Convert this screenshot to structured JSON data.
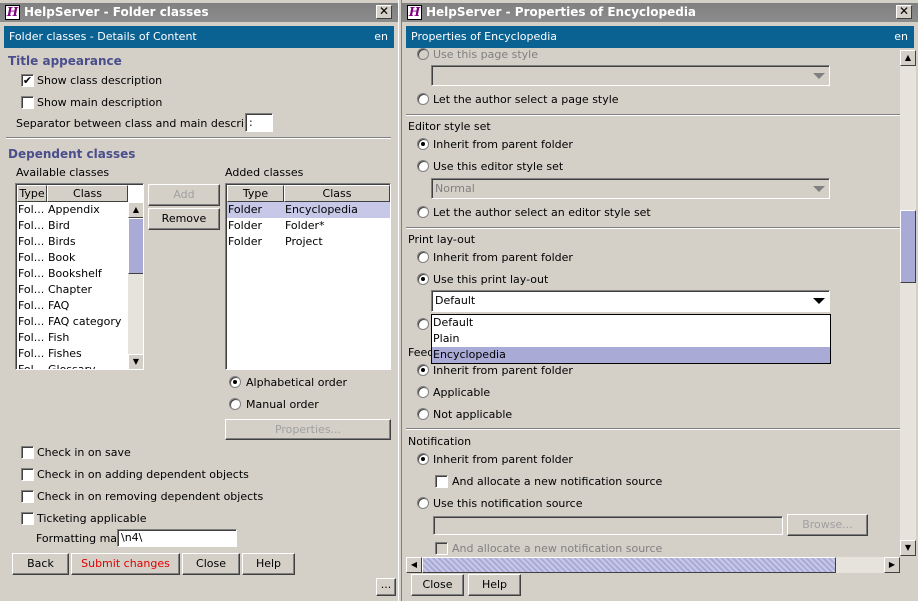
{
  "left": {
    "title": "HelpServer - Folder classes",
    "header": {
      "title": "Folder classes - Details of Content",
      "lang": "en"
    },
    "title_appearance": {
      "heading": "Title appearance",
      "show_class_description": "Show class description",
      "show_main_description": "Show main description",
      "separator_label": "Separator between class and main description",
      "separator_value": ":"
    },
    "dependent": {
      "heading": "Dependent classes",
      "available_label": "Available classes",
      "added_label": "Added classes",
      "col_type": "Type",
      "col_class": "Class",
      "available": [
        {
          "type": "Fol...",
          "cls": "Appendix"
        },
        {
          "type": "Fol...",
          "cls": "Bird"
        },
        {
          "type": "Fol...",
          "cls": "Birds"
        },
        {
          "type": "Fol...",
          "cls": "Book"
        },
        {
          "type": "Fol...",
          "cls": "Bookshelf"
        },
        {
          "type": "Fol...",
          "cls": "Chapter"
        },
        {
          "type": "Fol...",
          "cls": "FAQ"
        },
        {
          "type": "Fol...",
          "cls": "FAQ category"
        },
        {
          "type": "Fol...",
          "cls": "Fish"
        },
        {
          "type": "Fol...",
          "cls": "Fishes"
        },
        {
          "type": "Fol...",
          "cls": "Glossary"
        }
      ],
      "added": [
        {
          "type": "Folder",
          "cls": "Encyclopedia"
        },
        {
          "type": "Folder",
          "cls": "Folder*"
        },
        {
          "type": "Folder",
          "cls": "Project"
        }
      ],
      "add": "Add",
      "remove": "Remove",
      "alpha": "Alphabetical order",
      "manual": "Manual order",
      "properties": "Properties..."
    },
    "options": {
      "check_in_on_save": "Check in on save",
      "check_in_adding": "Check in on adding dependent objects",
      "check_in_removing": "Check in on removing dependent objects",
      "ticketing": "Ticketing applicable",
      "formatting_label": "Formatting mask",
      "formatting_value": "\\n4\\"
    },
    "footer": {
      "back": "Back",
      "submit": "Submit changes",
      "close": "Close",
      "help": "Help",
      "more": "..."
    }
  },
  "right": {
    "title": "HelpServer - Properties of Encyclopedia",
    "header": {
      "title": "Properties of Encyclopedia",
      "lang": "en"
    },
    "page_style": {
      "use": "Use this page style",
      "author": "Let the author select a page style"
    },
    "editor": {
      "heading": "Editor style set",
      "inherit": "Inherit from parent folder",
      "use": "Use this editor style set",
      "value": "Normal",
      "author": "Let the author select an editor style set"
    },
    "print": {
      "heading": "Print lay-out",
      "inherit": "Inherit from parent folder",
      "use": "Use this print lay-out",
      "value": "Default",
      "options": [
        "Default",
        "Plain",
        "Encyclopedia"
      ]
    },
    "feedback": {
      "heading": "Feed",
      "inherit": "Inherit from parent folder",
      "applicable": "Applicable",
      "not_applicable": "Not applicable"
    },
    "notification": {
      "heading": "Notification",
      "inherit": "Inherit from parent folder",
      "allocate": "And allocate a new notification source",
      "use": "Use this notification source",
      "browse": "Browse...",
      "allocate2": "And allocate a new notification source"
    },
    "footer": {
      "close": "Close",
      "help": "Help"
    }
  }
}
